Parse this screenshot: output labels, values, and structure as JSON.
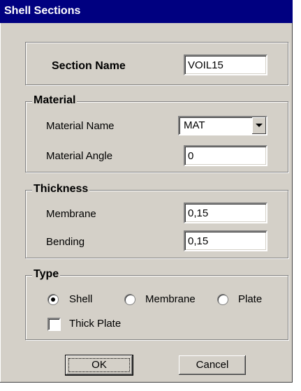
{
  "window": {
    "title": "Shell Sections"
  },
  "section_name": {
    "label": "Section Name",
    "value": "VOIL15"
  },
  "material": {
    "legend": "Material",
    "name_label": "Material Name",
    "name_value": "MAT",
    "angle_label": "Material Angle",
    "angle_value": "0"
  },
  "thickness": {
    "legend": "Thickness",
    "membrane_label": "Membrane",
    "membrane_value": "0,15",
    "bending_label": "Bending",
    "bending_value": "0,15"
  },
  "type": {
    "legend": "Type",
    "options": [
      "Shell",
      "Membrane",
      "Plate"
    ],
    "selected": "Shell",
    "thick_plate_label": "Thick Plate",
    "thick_plate_checked": false
  },
  "buttons": {
    "ok": "OK",
    "cancel": "Cancel"
  }
}
